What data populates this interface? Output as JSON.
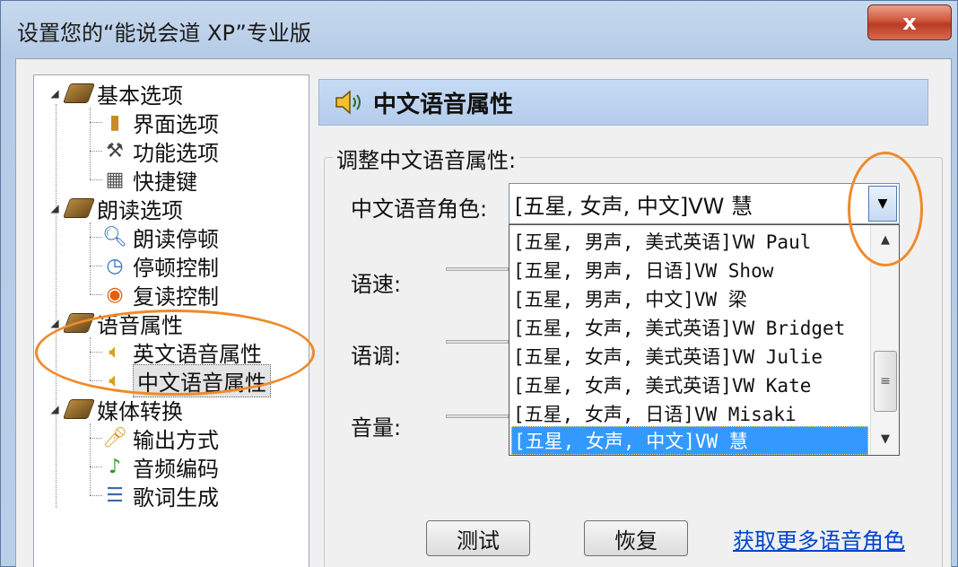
{
  "window": {
    "title": "设置您的“能说会道 XP”专业版",
    "close_glyph": "x"
  },
  "tree": {
    "groups": [
      {
        "label": "基本选项",
        "icon": "book-icon",
        "children": [
          {
            "label": "界面选项",
            "icon": "door-icon"
          },
          {
            "label": "功能选项",
            "icon": "hammer-icon"
          },
          {
            "label": "快捷键",
            "icon": "keypad-icon"
          }
        ]
      },
      {
        "label": "朗读选项",
        "icon": "book-icon",
        "children": [
          {
            "label": "朗读停顿",
            "icon": "magnifier-icon"
          },
          {
            "label": "停顿控制",
            "icon": "clock-icon"
          },
          {
            "label": "复读控制",
            "icon": "repeat-icon"
          }
        ]
      },
      {
        "label": "语音属性",
        "icon": "book-icon",
        "children": [
          {
            "label": "英文语音属性",
            "icon": "speaker-icon"
          },
          {
            "label": "中文语音属性",
            "icon": "speaker-icon",
            "selected": true
          }
        ]
      },
      {
        "label": "媒体转换",
        "icon": "book-icon",
        "children": [
          {
            "label": "输出方式",
            "icon": "microphone-icon"
          },
          {
            "label": "音频编码",
            "icon": "music-note-icon"
          },
          {
            "label": "歌词生成",
            "icon": "document-icon"
          }
        ]
      }
    ]
  },
  "panel": {
    "header_title": "中文语音属性",
    "group_label": "调整中文语音属性:",
    "voice_label": "中文语音角色:",
    "voice_selected": "[五星, 女声, 中文]VW 慧",
    "speed_label": "语速:",
    "pitch_label": "语调:",
    "volume_label": "音量:",
    "dropdown_options": [
      "[五星, 男声, 美式英语]VW Paul",
      "[五星, 男声, 日语]VW Show",
      "[五星, 男声, 中文]VW 梁",
      "[五星, 女声, 美式英语]VW Bridget",
      "[五星, 女声, 美式英语]VW Julie",
      "[五星, 女声, 美式英语]VW Kate",
      "[五星, 女声, 日语]VW Misaki",
      "[五星, 女声, 中文]VW 慧"
    ],
    "selected_option_index": 7,
    "test_button": "测试",
    "restore_button": "恢复",
    "more_voices_link": "获取更多语音角色"
  },
  "colors": {
    "annotation_ellipse": "#ef8a2a",
    "selection": "#3399ff",
    "link": "#0044cc"
  }
}
